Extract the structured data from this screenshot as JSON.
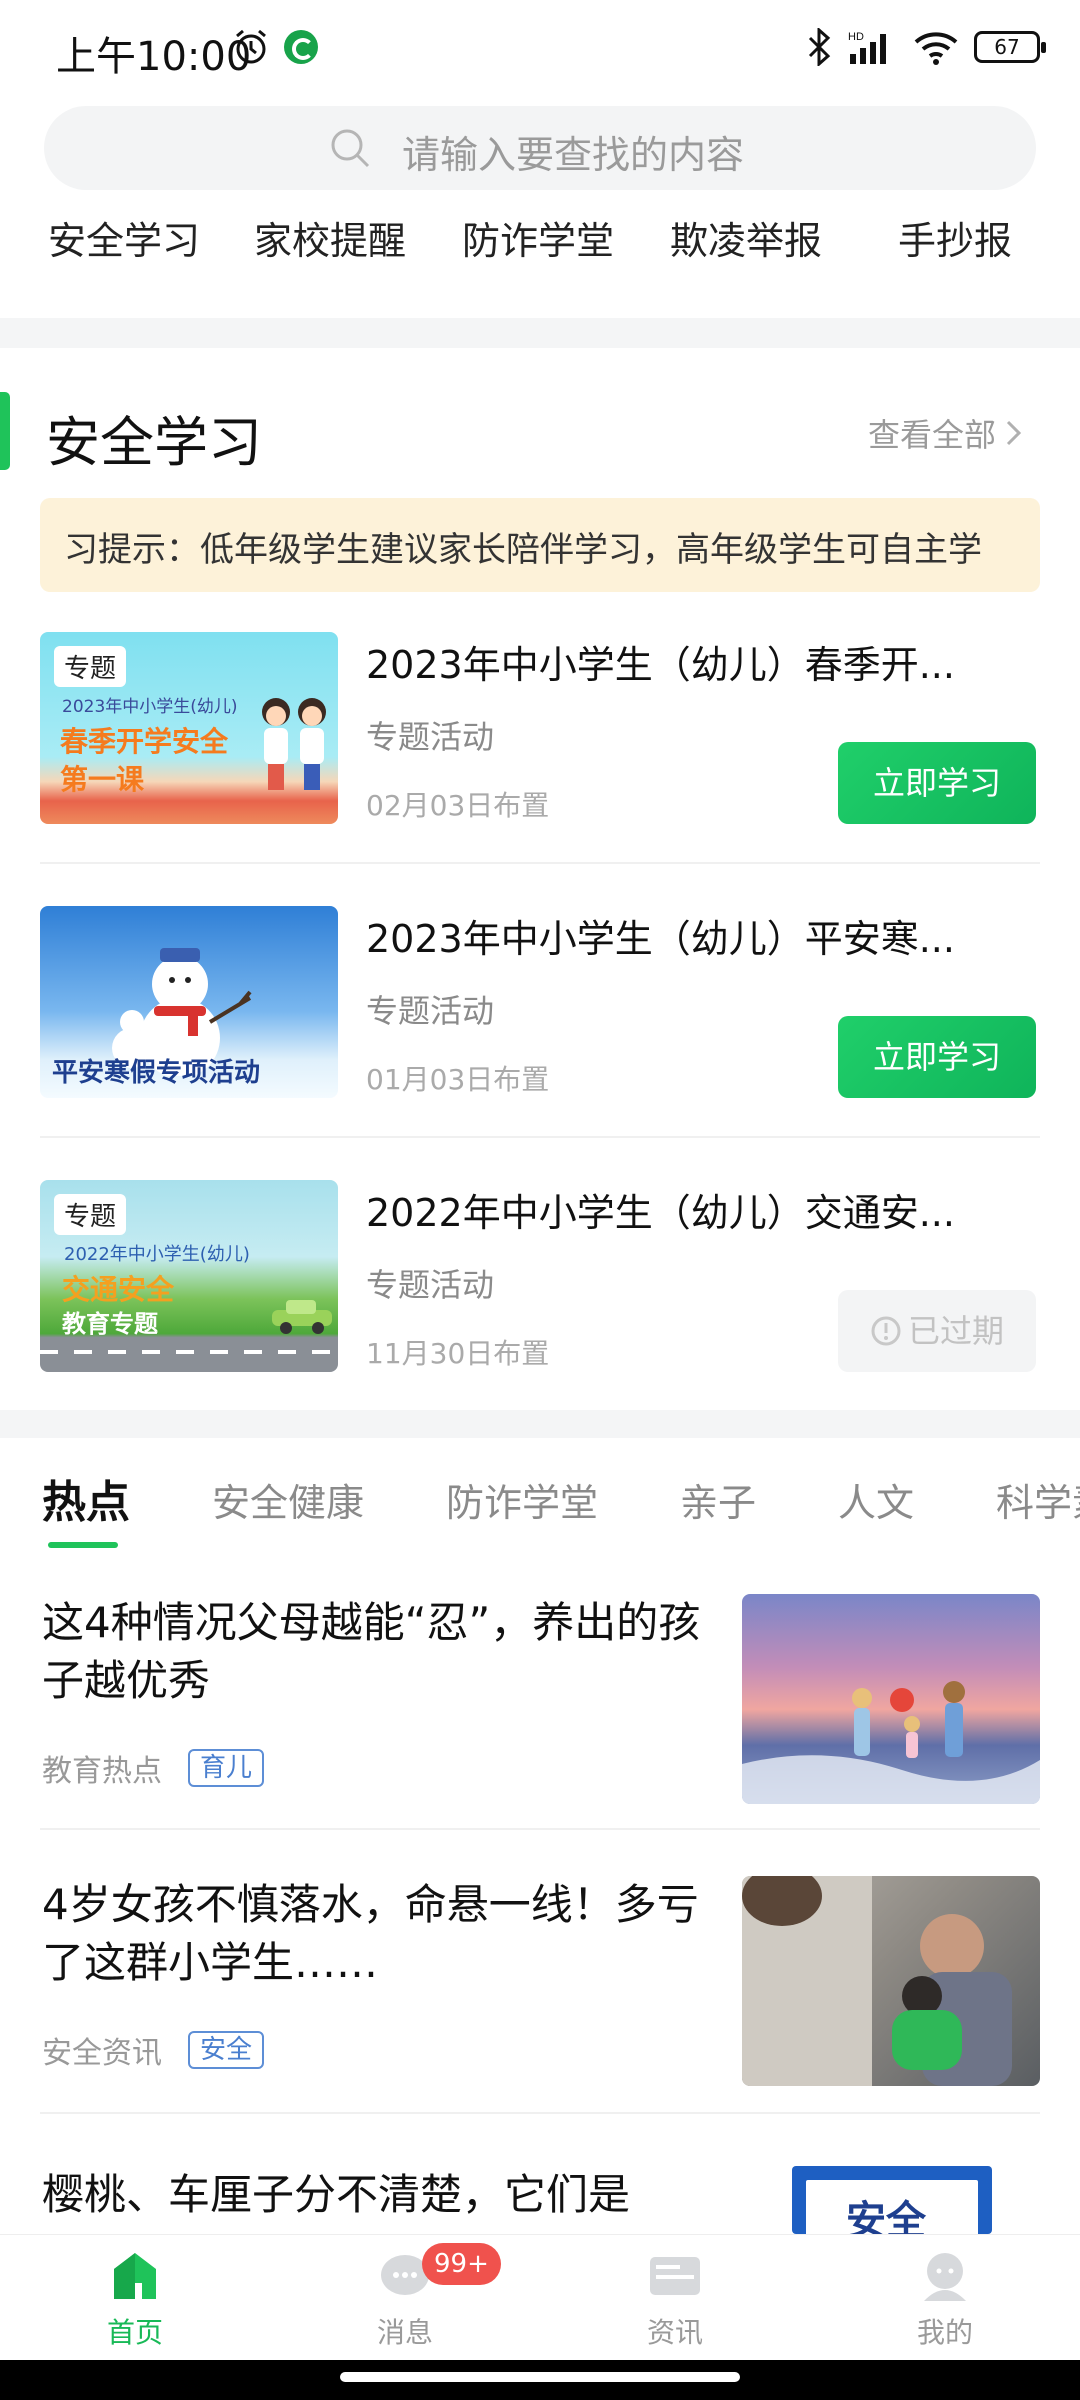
{
  "status_bar": {
    "time": "上午10:00",
    "battery": "67"
  },
  "search": {
    "placeholder": "请输入要查找的内容"
  },
  "quick_nav": [
    "安全学习",
    "家校提醒",
    "防诈学堂",
    "欺凌举报",
    "手抄报"
  ],
  "safety_section": {
    "title": "安全学习",
    "view_all": "查看全部",
    "tip": "习提示：低年级学生建议家长陪伴学习，高年级学生可自主学",
    "items": [
      {
        "title": "2023年中小学生（幼儿）春季开...",
        "category": "专题活动",
        "date": "02月03日布置",
        "action": "立即学习",
        "tag": "专题",
        "thumb_line1": "2023年中小学生(幼儿)",
        "thumb_line2": "春季开学安全",
        "thumb_line3": "第一课"
      },
      {
        "title": "2023年中小学生（幼儿）平安寒...",
        "category": "专题活动",
        "date": "01月03日布置",
        "action": "立即学习",
        "thumb_line1": "平安寒假专项活动"
      },
      {
        "title": "2022年中小学生（幼儿）交通安...",
        "category": "专题活动",
        "date": "11月30日布置",
        "action": "已过期",
        "tag": "专题",
        "thumb_line1": "2022年中小学生(幼儿)",
        "thumb_line2": "交通安全",
        "thumb_line3": "教育专题"
      }
    ]
  },
  "content_tabs": [
    "热点",
    "安全健康",
    "防诈学堂",
    "亲子",
    "人文",
    "科学素"
  ],
  "news": [
    {
      "title": "这4种情况父母越能“忍”，养出的孩子越优秀",
      "source": "教育热点",
      "badge": "育儿"
    },
    {
      "title": "4岁女孩不慎落水，命悬一线！多亏了这群小学生……",
      "source": "安全资讯",
      "badge": "安全"
    },
    {
      "title": "樱桃、车厘子分不清楚，它们是",
      "thumb_text": "安全"
    }
  ],
  "bottom_nav": {
    "items": [
      "首页",
      "消息",
      "资讯",
      "我的"
    ],
    "message_badge": "99+"
  },
  "colors": {
    "accent": "#1fc35a",
    "tip_bg": "#fdf2d9",
    "badge_blue": "#4a7fcf",
    "badge_red": "#f0524d"
  }
}
